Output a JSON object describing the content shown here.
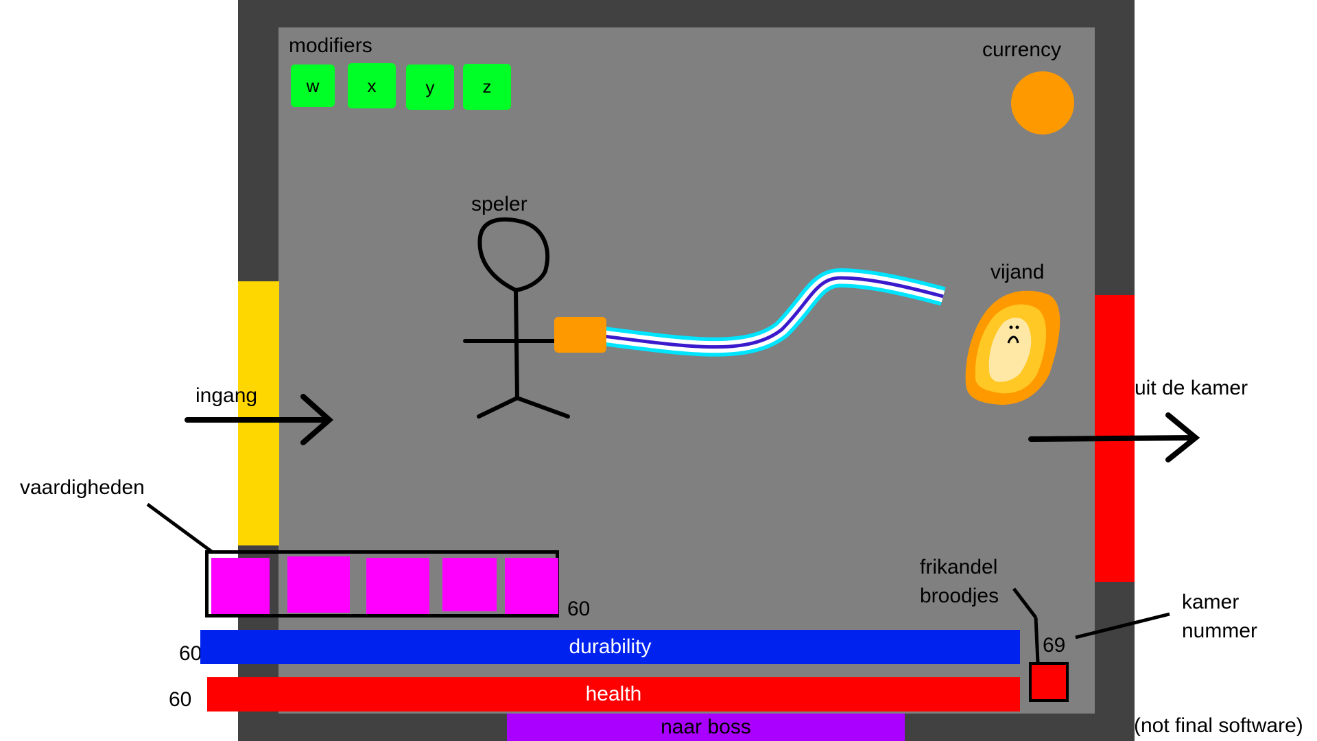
{
  "room": {
    "wall_color": "#414141",
    "floor_color": "#808080"
  },
  "modifiers": {
    "label": "modifiers",
    "keys": [
      "w",
      "x",
      "y",
      "z"
    ],
    "color": "#00ff26"
  },
  "currency": {
    "label": "currency",
    "color": "#ff9900"
  },
  "player": {
    "label": "speler"
  },
  "weapon": {
    "handle_color": "#ff9900",
    "beam_colors": [
      "#00e5ff",
      "#ffffff",
      "#3a1acc"
    ]
  },
  "enemy": {
    "label": "vijand"
  },
  "entrance": {
    "label": "ingang",
    "color": "#ffd700"
  },
  "exit": {
    "label": "uit de kamer",
    "color": "#ff0000"
  },
  "skills": {
    "label": "vaardigheden",
    "slot_count": 5,
    "value": "60",
    "slot_color": "#ff00ff"
  },
  "bars": {
    "durability": {
      "label": "durability",
      "value": "60",
      "color": "#0022ee"
    },
    "health": {
      "label": "health",
      "value": "60",
      "color": "#ff0000"
    },
    "boss": {
      "label": "naar boss",
      "color": "#aa00ff"
    }
  },
  "frikandel": {
    "label_line1": "frikandel",
    "label_line2": "broodjes"
  },
  "room_number": {
    "label_line1": "kamer",
    "label_line2": "nummer",
    "value": "69"
  },
  "disclaimer": "(not final software)"
}
